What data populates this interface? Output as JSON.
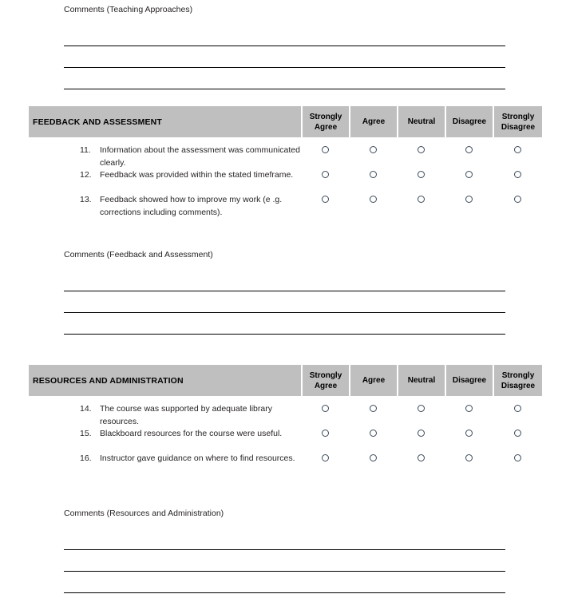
{
  "colors": {
    "header_background": "#bfbfbf",
    "header_text": "#000000",
    "body_text": "#231f20",
    "line": "#000000",
    "radio_border": "#3b4a5a",
    "page_background": "#ffffff"
  },
  "scale_columns": [
    "Strongly Agree",
    "Agree",
    "Neutral",
    "Disagree",
    "Strongly Disagree"
  ],
  "top_comments": {
    "label": "Comments (Teaching Approaches)",
    "line_count": 3
  },
  "sections": [
    {
      "title": "FEEDBACK AND ASSESSMENT",
      "scale_columns": [
        "Strongly Agree",
        "Agree",
        "Neutral",
        "Disagree",
        "Strongly Disagree"
      ],
      "questions": [
        {
          "number": "11.",
          "text": "Information about the assessment was communicated clearly."
        },
        {
          "number": "12.",
          "text": "Feedback was provided within the stated timeframe."
        },
        {
          "number": "13.",
          "text": "Feedback showed how to improve my work (e .g. corrections including comments)."
        }
      ],
      "comments": {
        "label": "Comments (Feedback and Assessment)",
        "line_count": 3
      }
    },
    {
      "title": "RESOURCES AND ADMINISTRATION",
      "scale_columns": [
        "Strongly Agree",
        "Agree",
        "Neutral",
        "Disagree",
        "Strongly Disagree"
      ],
      "questions": [
        {
          "number": "14.",
          "text": "The course was supported by adequate library resources."
        },
        {
          "number": "15.",
          "text": "Blackboard resources for the course were useful."
        },
        {
          "number": "16.",
          "text": "Instructor gave guidance on where to find resources."
        }
      ],
      "comments": {
        "label": "Comments (Resources and Administration)",
        "line_count": 3
      }
    }
  ]
}
